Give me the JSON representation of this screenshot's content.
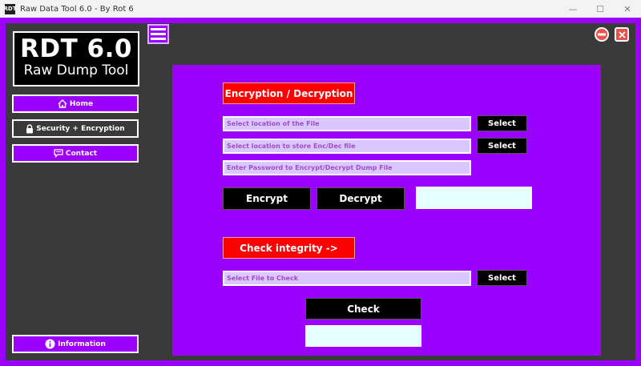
{
  "window": {
    "title": "Raw Data Tool 6.0 - By Rot 6",
    "icon_text": "RDT",
    "minimize_glyph": "—",
    "maximize_glyph": "☐",
    "close_glyph": "✕"
  },
  "logo": {
    "title": "RDT 6.0",
    "subtitle": "Raw Dump Tool"
  },
  "sidebar": {
    "items": [
      {
        "label": "Home",
        "icon": "home-icon"
      },
      {
        "label": "Security + Encryption",
        "icon": "lock-icon"
      },
      {
        "label": "Contact",
        "icon": "chat-icon"
      }
    ],
    "information": {
      "label": "Information",
      "icon": "info-icon"
    }
  },
  "encryption": {
    "header_label": "Encryption / Decryption",
    "file_placeholder": "Select location of the File",
    "store_placeholder": "Select location to store Enc/Dec file",
    "password_placeholder": "Enter Password to Encrypt/Decrypt Dump File",
    "select_label": "Select",
    "encrypt_label": "Encrypt",
    "decrypt_label": "Decrypt"
  },
  "integrity": {
    "header_label": "Check integrity ->",
    "file_placeholder": "Select File to Check",
    "select_label": "Select",
    "check_label": "Check"
  },
  "colors": {
    "accent_purple": "#9b00ff",
    "background_dark": "#3a3a3a",
    "header_red": "#ff0000",
    "field_lavender": "#d9c8ff",
    "output_box": "#e6ffff"
  }
}
